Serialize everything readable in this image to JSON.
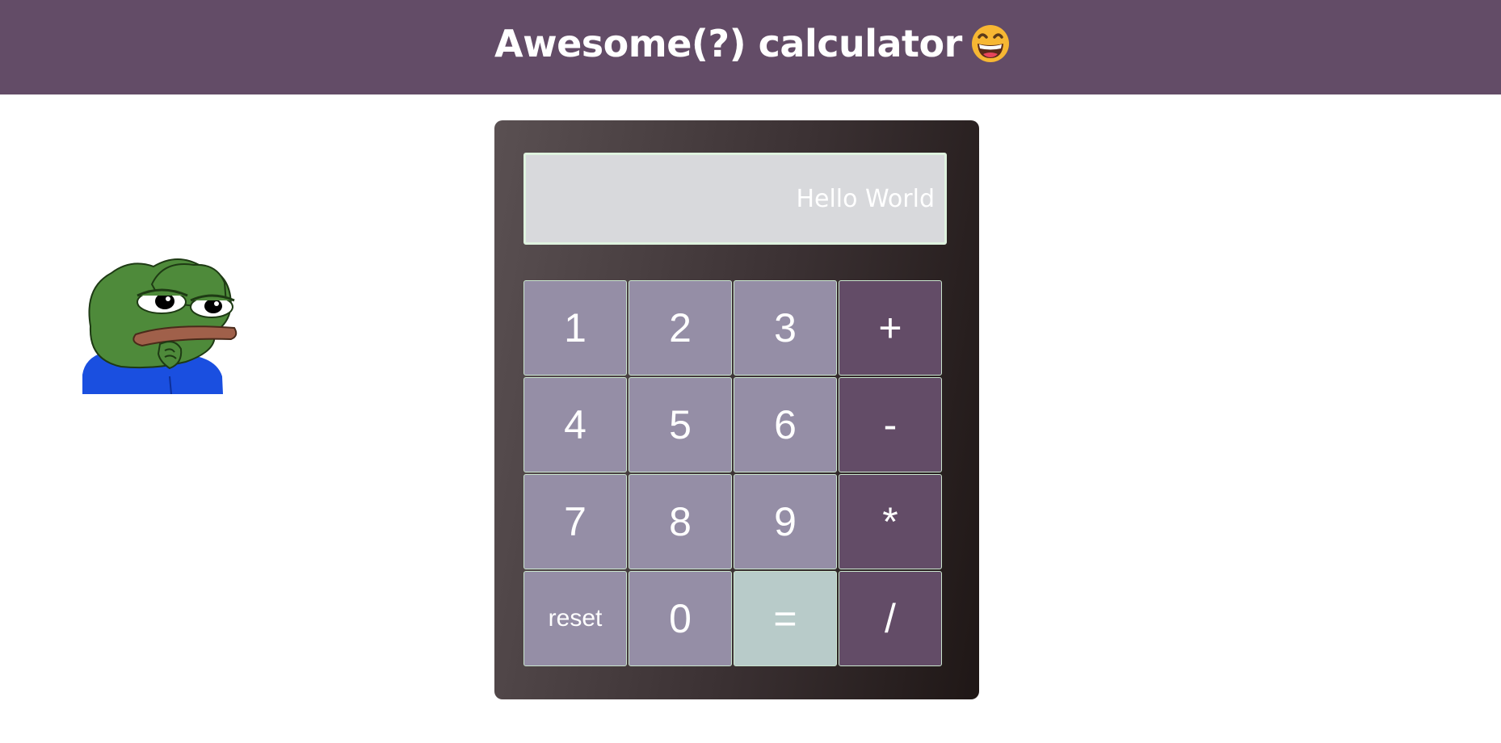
{
  "header": {
    "title": "Awesome(?) calculator",
    "emoji_icon": "grinning-face-emoji",
    "background": "#634c67"
  },
  "sidebar_image": {
    "icon": "pepe-frog-thinking-sticker"
  },
  "calculator": {
    "display": "Hello World",
    "keys": [
      {
        "label": "1",
        "kind": "number"
      },
      {
        "label": "2",
        "kind": "number"
      },
      {
        "label": "3",
        "kind": "number"
      },
      {
        "label": "+",
        "kind": "operator"
      },
      {
        "label": "4",
        "kind": "number"
      },
      {
        "label": "5",
        "kind": "number"
      },
      {
        "label": "6",
        "kind": "number"
      },
      {
        "label": "-",
        "kind": "operator"
      },
      {
        "label": "7",
        "kind": "number"
      },
      {
        "label": "8",
        "kind": "number"
      },
      {
        "label": "9",
        "kind": "number"
      },
      {
        "label": "*",
        "kind": "operator"
      },
      {
        "label": "reset",
        "kind": "reset"
      },
      {
        "label": "0",
        "kind": "number"
      },
      {
        "label": "=",
        "kind": "equals"
      },
      {
        "label": "/",
        "kind": "operator"
      }
    ],
    "colors": {
      "number": "#958ea6",
      "operator": "#634c67",
      "equals": "#b8cbc9",
      "display": "#d8d9dc"
    }
  }
}
